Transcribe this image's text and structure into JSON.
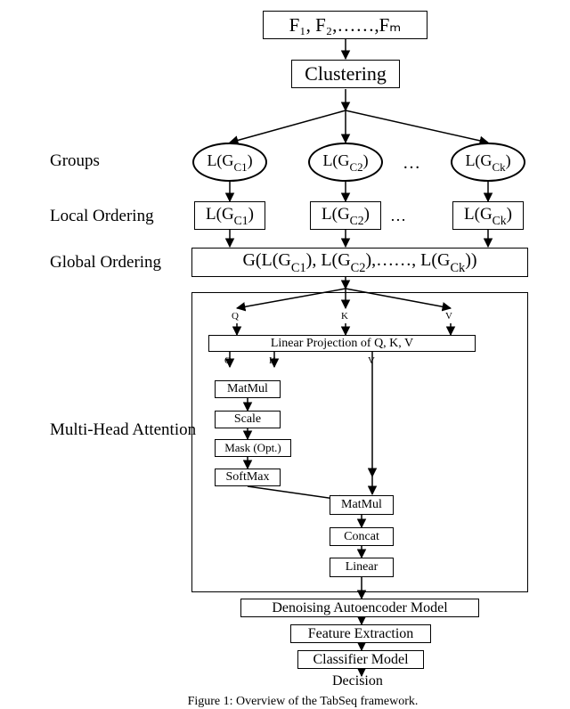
{
  "input_box": "F₁, F₂,……,Fₘ",
  "clustering_box": "Clustering",
  "label_groups": "Groups",
  "group1": "L(G_{C1})",
  "group2": "L(G_{C2})",
  "groupk": "L(G_{Ck})",
  "group_dots": "…",
  "label_local": "Local Ordering",
  "local1": "L(G_{C1})",
  "local2": "L(G_{C2})",
  "localk": "L(G_{Ck})",
  "local_dots": "…",
  "label_global": "Global Ordering",
  "global_box": "G(L(G_{C1}), L(G_{C2}),……, L(G_{Ck}))",
  "label_mha": "Multi-Head Attention",
  "qkv": {
    "q": "Q",
    "k": "K",
    "v": "V"
  },
  "linproj": "Linear Projection of Q, K, V",
  "matmul1": "MatMul",
  "scale": "Scale",
  "mask": "Mask (Opt.)",
  "softmax": "SoftMax",
  "matmul2": "MatMul",
  "concat": "Concat",
  "linear": "Linear",
  "dae": "Denoising Autoencoder Model",
  "featext": "Feature Extraction",
  "clf": "Classifier Model",
  "decision": "Decision",
  "caption": "Figure 1: Overview of the TabSeq framework."
}
